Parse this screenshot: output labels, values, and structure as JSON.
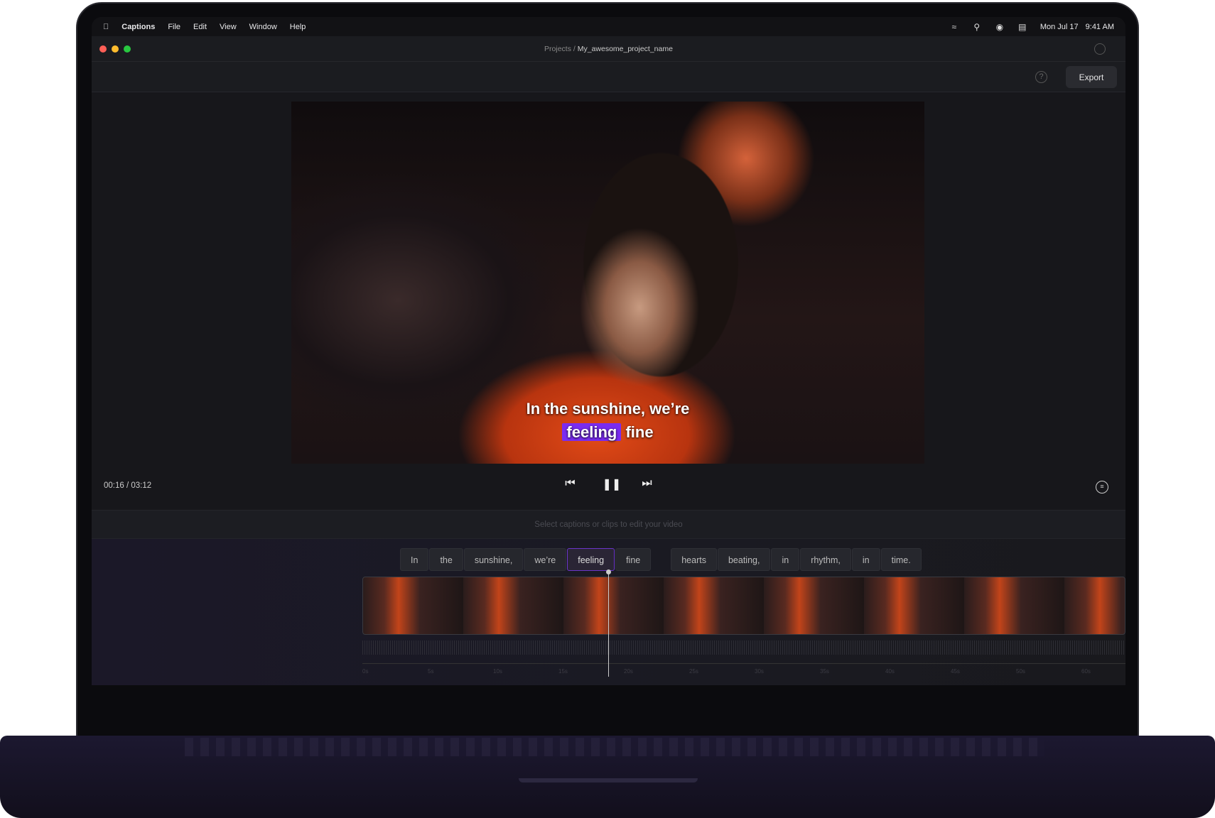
{
  "menubar": {
    "app": "Captions",
    "items": [
      "File",
      "Edit",
      "View",
      "Window",
      "Help"
    ],
    "date": "Mon Jul 17",
    "time": "9:41 AM"
  },
  "titlebar": {
    "crumb_root": "Projects /",
    "project": "My_awesome_project_name"
  },
  "toolbar": {
    "help": "?",
    "export": "Export"
  },
  "video": {
    "caption_line1": "In the sunshine, we’re",
    "caption_highlight": "feeling",
    "caption_rest": "fine",
    "highlight_color": "#7a2cf0"
  },
  "player": {
    "timecode": "00:16 / 03:12"
  },
  "hint": "Select captions or clips to edit your video",
  "words_group1": [
    "In",
    "the",
    "sunshine,",
    "we’re",
    "feeling",
    "fine"
  ],
  "words_group2": [
    "hearts",
    "beating,",
    "in",
    "rhythm,",
    "in",
    "time."
  ],
  "selected_word": "feeling",
  "ruler": [
    "0s",
    "5s",
    "10s",
    "15s",
    "20s",
    "25s",
    "30s",
    "35s",
    "40s",
    "45s",
    "50s",
    "60s"
  ]
}
